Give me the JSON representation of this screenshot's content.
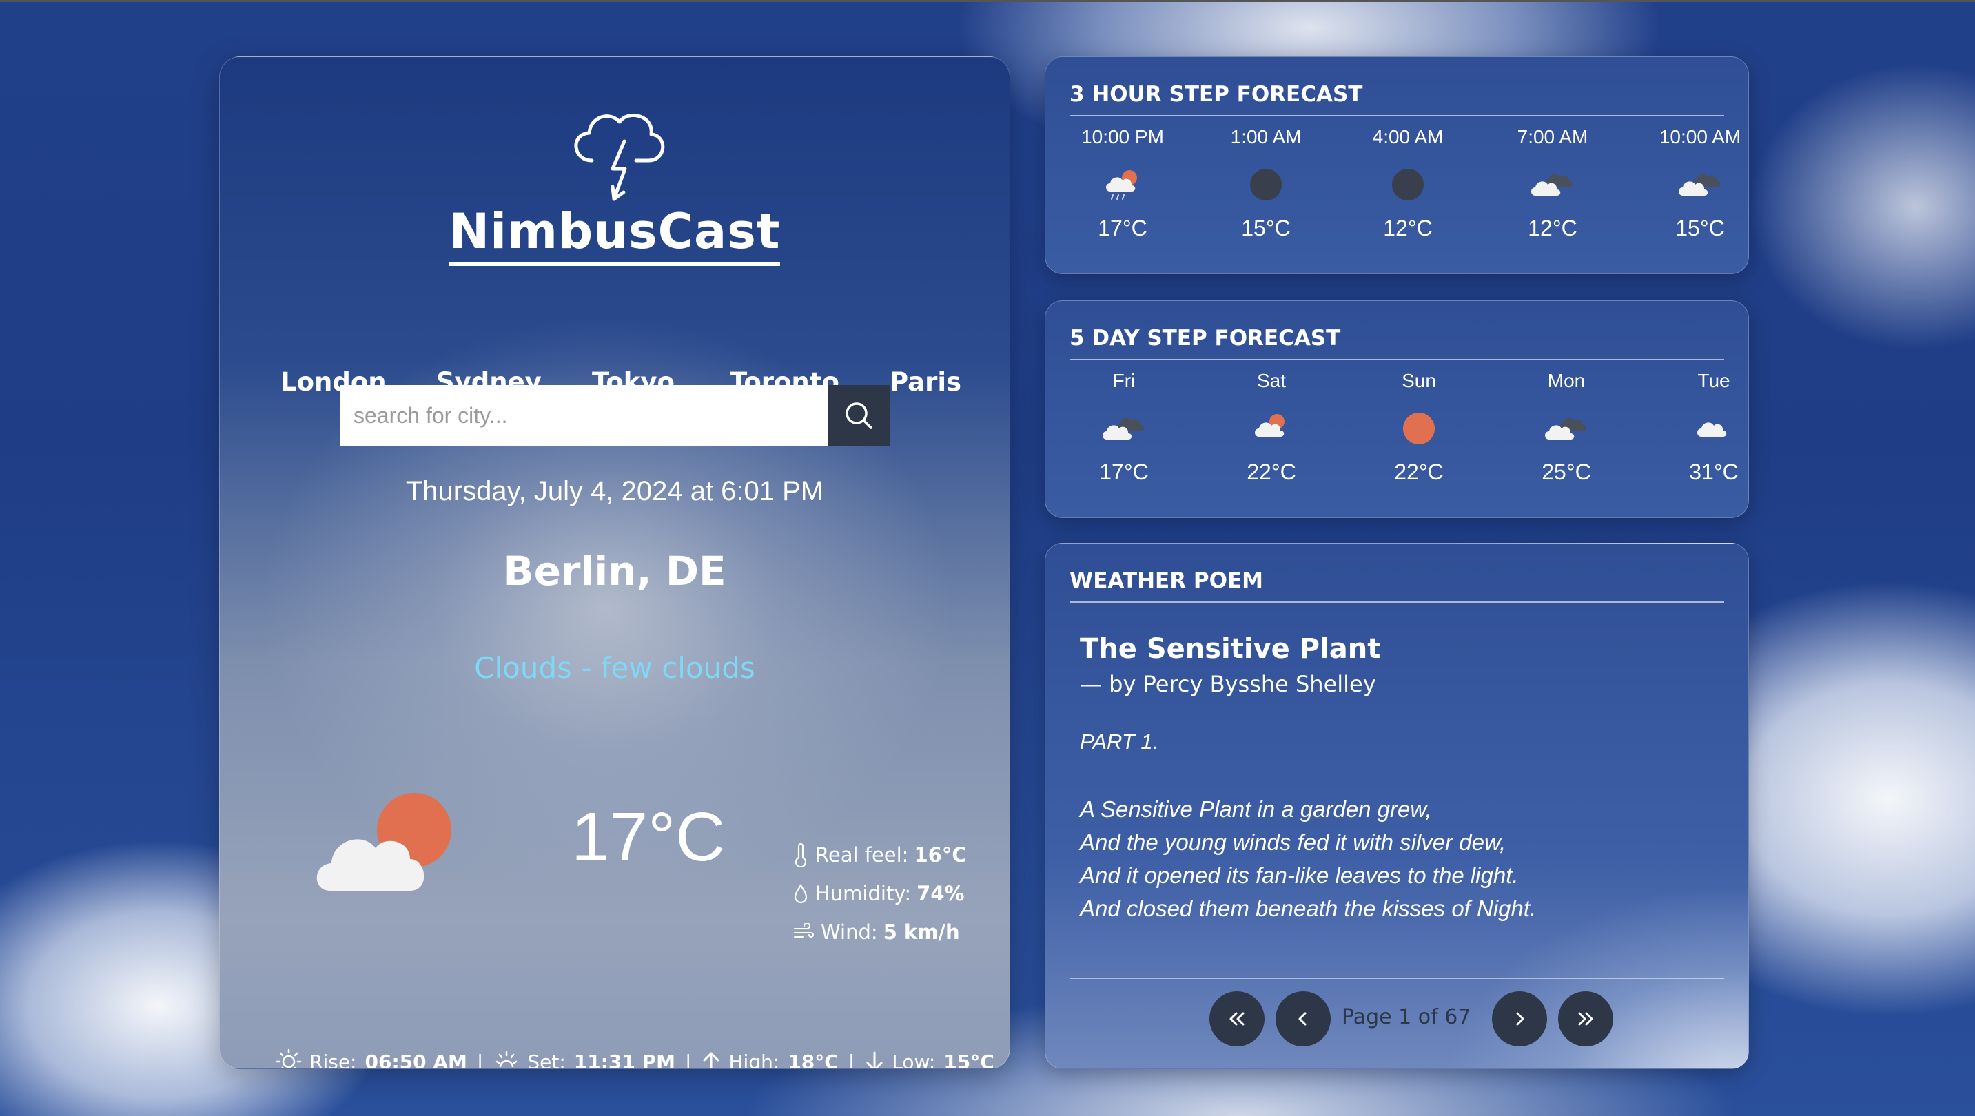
{
  "app": {
    "title": "NimbusCast"
  },
  "cities": [
    "London",
    "Sydney",
    "Tokyo",
    "Toronto",
    "Paris"
  ],
  "search": {
    "placeholder": "search for city..."
  },
  "current": {
    "datetime": "Thursday, July 4, 2024 at 6:01 PM",
    "location": "Berlin, DE",
    "condition": "Clouds - few clouds",
    "temperature": "17°C",
    "real_feel_label": "Real feel:",
    "real_feel": "16°C",
    "humidity_label": "Humidity:",
    "humidity": "74%",
    "wind_label": "Wind:",
    "wind": "5 km/h",
    "sunrise_label": "Rise:",
    "sunrise": "06:50 AM",
    "sunset_label": "Set:",
    "sunset": "11:31 PM",
    "high_label": "High:",
    "high": "18°C",
    "low_label": "Low:",
    "low": "15°C",
    "icon": "few-clouds-icon"
  },
  "hourly": {
    "title": "3 HOUR STEP FORECAST",
    "items": [
      {
        "time": "10:00 PM",
        "temp": "17°C",
        "icon": "rain-sun-icon"
      },
      {
        "time": "1:00 AM",
        "temp": "15°C",
        "icon": "clear-night-icon"
      },
      {
        "time": "4:00 AM",
        "temp": "12°C",
        "icon": "clear-night-icon"
      },
      {
        "time": "7:00 AM",
        "temp": "12°C",
        "icon": "broken-clouds-icon"
      },
      {
        "time": "10:00 AM",
        "temp": "15°C",
        "icon": "broken-clouds-icon"
      }
    ]
  },
  "daily": {
    "title": "5 DAY STEP FORECAST",
    "items": [
      {
        "day": "Fri",
        "temp": "17°C",
        "icon": "broken-clouds-icon"
      },
      {
        "day": "Sat",
        "temp": "22°C",
        "icon": "few-clouds-icon"
      },
      {
        "day": "Sun",
        "temp": "22°C",
        "icon": "clear-sun-icon"
      },
      {
        "day": "Mon",
        "temp": "25°C",
        "icon": "broken-clouds-icon"
      },
      {
        "day": "Tue",
        "temp": "31°C",
        "icon": "cloud-icon"
      }
    ]
  },
  "poem": {
    "section_title": "WEATHER POEM",
    "title": "The Sensitive Plant",
    "author": "— by Percy Bysshe Shelley",
    "part": "PART 1.",
    "lines": [
      "A Sensitive Plant in a garden grew,",
      "And the young winds fed it with silver dew,",
      "And it opened its fan-like leaves to the light.",
      "And closed them beneath the kisses of Night."
    ],
    "page_text": "Page 1 of 67"
  },
  "colors": {
    "accent_condition": "#7fd8f5",
    "sun": "#e0704f",
    "button_dark": "#2d3748"
  }
}
